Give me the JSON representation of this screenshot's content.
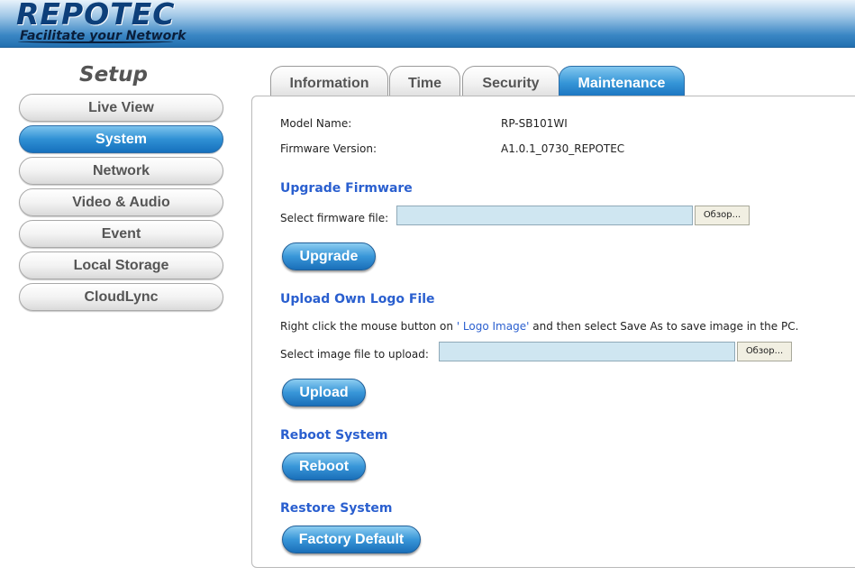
{
  "header": {
    "logo_main": "REPOTEC",
    "logo_sub": "Facilitate your Network"
  },
  "sidebar": {
    "title": "Setup",
    "items": [
      {
        "label": "Live View",
        "active": false
      },
      {
        "label": "System",
        "active": true
      },
      {
        "label": "Network",
        "active": false
      },
      {
        "label": "Video & Audio",
        "active": false
      },
      {
        "label": "Event",
        "active": false
      },
      {
        "label": "Local Storage",
        "active": false
      },
      {
        "label": "CloudLync",
        "active": false
      }
    ]
  },
  "tabs": [
    {
      "label": "Information",
      "active": false
    },
    {
      "label": "Time",
      "active": false
    },
    {
      "label": "Security",
      "active": false
    },
    {
      "label": "Maintenance",
      "active": true
    }
  ],
  "info": {
    "model_label": "Model Name:",
    "model_value": "RP-SB101WI",
    "firmware_label": "Firmware Version:",
    "firmware_value": "A1.0.1_0730_REPOTEC"
  },
  "upgrade": {
    "title": "Upgrade Firmware",
    "file_label": "Select firmware file:",
    "file_value": "",
    "browse_label": "Обзор...",
    "button_label": "Upgrade"
  },
  "logo_upload": {
    "title": "Upload Own Logo File",
    "hint_prefix": "Right click the mouse button on",
    "hint_link": "' Logo Image'",
    "hint_suffix": "and then select Save As to save image in the PC.",
    "file_label": "Select image file to upload:",
    "file_value": "",
    "browse_label": "Обзор...",
    "button_label": "Upload"
  },
  "reboot": {
    "title": "Reboot System",
    "button_label": "Reboot"
  },
  "restore": {
    "title": "Restore System",
    "button_label": "Factory Default"
  },
  "colors": {
    "accent_blue": "#2f90d4",
    "section_title": "#2a5fcf",
    "header_dark": "#0d3f7a"
  }
}
